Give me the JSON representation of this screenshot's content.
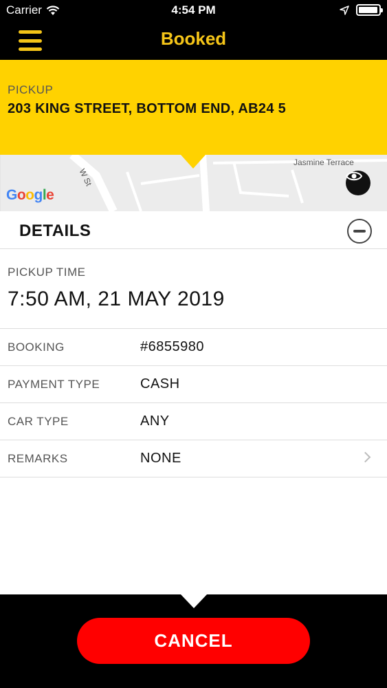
{
  "status_bar": {
    "carrier": "Carrier",
    "time": "4:54 PM",
    "battery_level": 0.95
  },
  "nav": {
    "title": "Booked"
  },
  "pickup": {
    "label": "PICKUP",
    "address": "203 KING STREET, BOTTOM END, AB24 5"
  },
  "map": {
    "street_label_1": "Jasmine Terrace",
    "street_label_2": "W St",
    "google_logo": [
      "G",
      "o",
      "o",
      "g",
      "l",
      "e"
    ],
    "google_colors": [
      "#4285F4",
      "#EA4335",
      "#FBBC05",
      "#4285F4",
      "#34A853",
      "#EA4335"
    ]
  },
  "details": {
    "title": "DETAILS",
    "pickup_time_label": "PICKUP TIME",
    "pickup_time_value": "7:50 AM, 21 MAY 2019",
    "rows": [
      {
        "label": "BOOKING",
        "value": "#6855980"
      },
      {
        "label": "PAYMENT TYPE",
        "value": "CASH"
      },
      {
        "label": "CAR TYPE",
        "value": "ANY"
      },
      {
        "label": "REMARKS",
        "value": "NONE"
      }
    ]
  },
  "footer": {
    "cancel_label": "CANCEL"
  },
  "colors": {
    "accent_yellow": "#ffd200",
    "title_yellow": "#f5c518",
    "cancel_red": "#ff0000"
  },
  "icons": {
    "wifi": "wifi-icon",
    "location": "location-arrow-icon",
    "battery": "battery-icon",
    "menu": "hamburger-menu-icon",
    "eye": "eye-icon",
    "collapse": "minus-circle-icon",
    "chevron": "chevron-right-icon"
  }
}
